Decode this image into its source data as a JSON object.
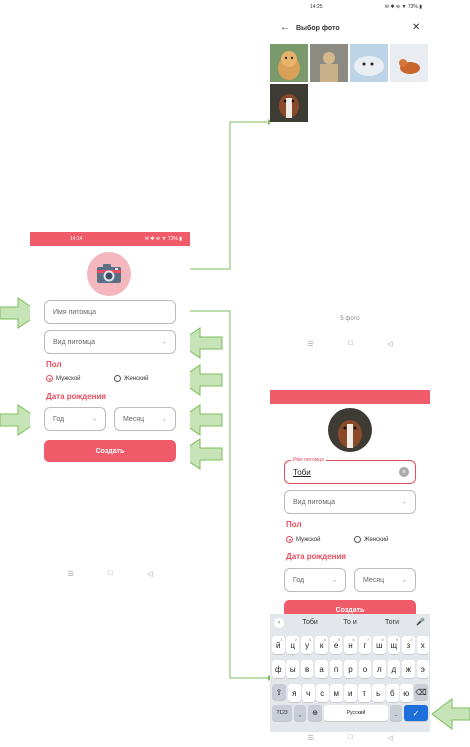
{
  "colors": {
    "accent": "#e84f5e",
    "bar": "#ef5b68",
    "arrow": "#7dbd5e"
  },
  "form_screen": {
    "status_time": "14:14",
    "status_right": "✉ ✱ ⊜ ▼ 73% ▮",
    "pet_name_placeholder": "Имя питомца",
    "pet_type_placeholder": "Вид питомца",
    "gender_label": "Пол",
    "gender_male": "Мужской",
    "gender_female": "Женский",
    "birth_label": "Дата рождения",
    "year": "Год",
    "month": "Месяц",
    "create_button": "Создать",
    "nav": [
      "☰",
      "□",
      "◁"
    ]
  },
  "picker_screen": {
    "status_time": "14:25",
    "status_right": "✉ ✱ ⊜ ▼ 73% ▮",
    "title": "Выбор фото",
    "photo_count": "5 фото",
    "nav": [
      "☰",
      "□",
      "◁"
    ]
  },
  "filled_screen": {
    "pet_name_label": "Имя питомца",
    "pet_name_value": "Тоби",
    "pet_type_placeholder": "Вид питомца",
    "gender_label": "Пол",
    "gender_male": "Мужской",
    "gender_female": "Женский",
    "birth_label": "Дата рождения",
    "year": "Год",
    "month": "Месяц",
    "create_button": "Создать",
    "suggestions": [
      "Тоби",
      "То и",
      "Тоги"
    ],
    "keyboard_row1": [
      "й",
      "ц",
      "у",
      "к",
      "е",
      "н",
      "г",
      "ш",
      "щ",
      "з",
      "х"
    ],
    "keyboard_row1_sub": [
      "1",
      "2",
      "3",
      "4",
      "5",
      "6",
      "7",
      "8",
      "9",
      "0",
      ""
    ],
    "keyboard_row2": [
      "ф",
      "ы",
      "в",
      "а",
      "п",
      "р",
      "о",
      "л",
      "д",
      "ж",
      "э"
    ],
    "keyboard_row3": [
      "я",
      "ч",
      "с",
      "м",
      "и",
      "т",
      "ь",
      "б",
      "ю"
    ],
    "key_numbers": "?123",
    "key_space": "Русский",
    "key_dot": ".",
    "nav": [
      "☰",
      "□",
      "◁"
    ]
  }
}
